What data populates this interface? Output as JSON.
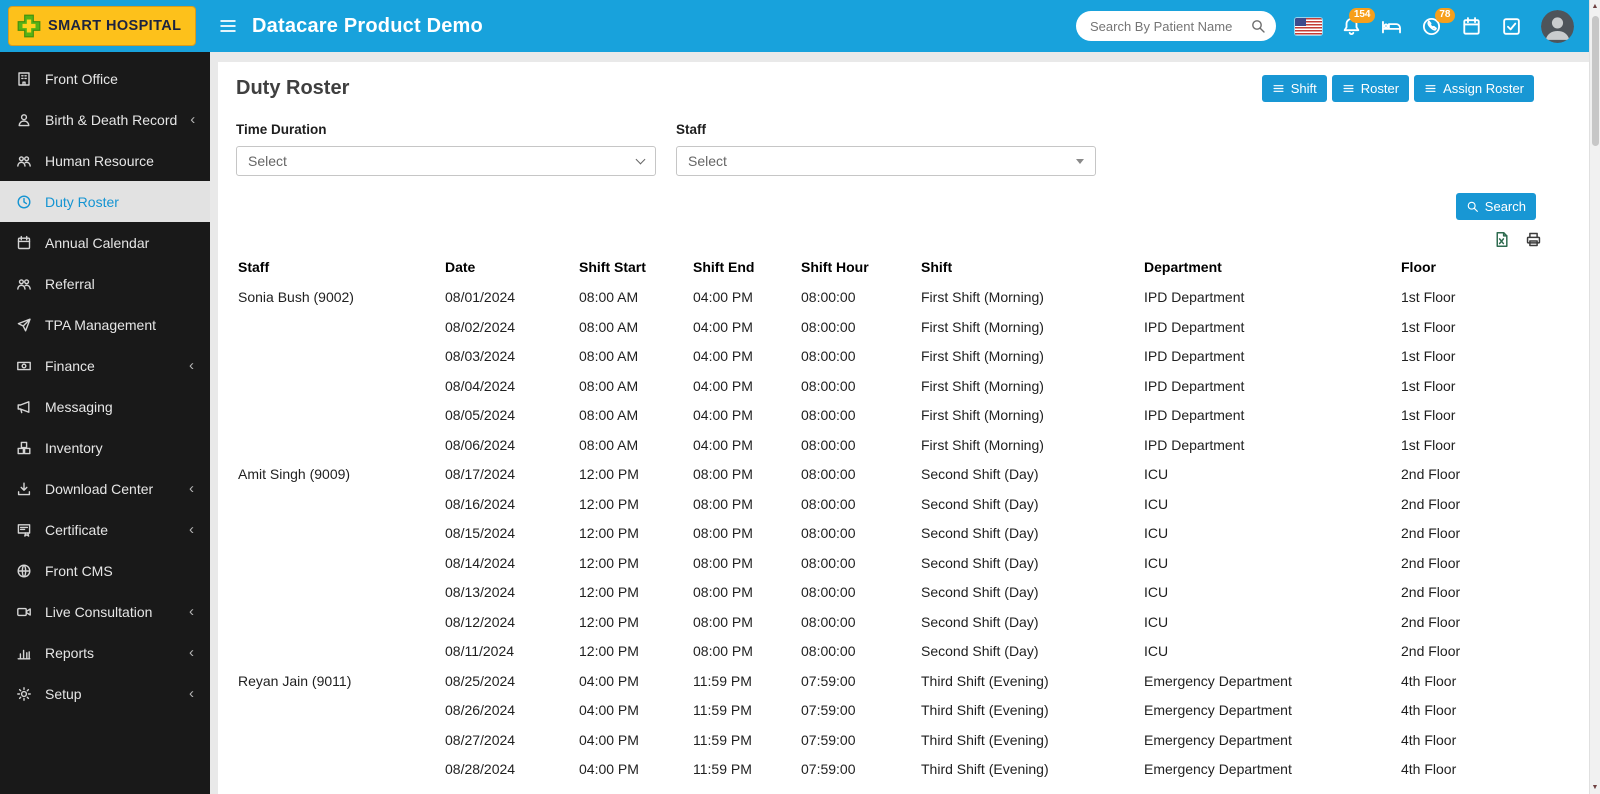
{
  "header": {
    "logo_text": "SMART HOSPITAL",
    "title": "Datacare Product Demo",
    "search_placeholder": "Search By Patient Name",
    "notification_count": "154",
    "message_count": "78"
  },
  "sidebar": {
    "items": [
      {
        "label": "Front Office",
        "icon": "front-office-icon",
        "chevron": false,
        "active": false
      },
      {
        "label": "Birth & Death Record",
        "icon": "birth-death-icon",
        "chevron": true,
        "active": false
      },
      {
        "label": "Human Resource",
        "icon": "human-resource-icon",
        "chevron": false,
        "active": false
      },
      {
        "label": "Duty Roster",
        "icon": "clock-icon",
        "chevron": false,
        "active": true
      },
      {
        "label": "Annual Calendar",
        "icon": "calendar-icon",
        "chevron": false,
        "active": false
      },
      {
        "label": "Referral",
        "icon": "users-icon",
        "chevron": false,
        "active": false
      },
      {
        "label": "TPA Management",
        "icon": "plane-icon",
        "chevron": false,
        "active": false
      },
      {
        "label": "Finance",
        "icon": "finance-icon",
        "chevron": true,
        "active": false
      },
      {
        "label": "Messaging",
        "icon": "megaphone-icon",
        "chevron": false,
        "active": false
      },
      {
        "label": "Inventory",
        "icon": "inventory-icon",
        "chevron": false,
        "active": false
      },
      {
        "label": "Download Center",
        "icon": "download-icon",
        "chevron": true,
        "active": false
      },
      {
        "label": "Certificate",
        "icon": "certificate-icon",
        "chevron": true,
        "active": false
      },
      {
        "label": "Front CMS",
        "icon": "globe-icon",
        "chevron": false,
        "active": false
      },
      {
        "label": "Live Consultation",
        "icon": "video-icon",
        "chevron": true,
        "active": false
      },
      {
        "label": "Reports",
        "icon": "chart-icon",
        "chevron": true,
        "active": false
      },
      {
        "label": "Setup",
        "icon": "gears-icon",
        "chevron": true,
        "active": false
      }
    ]
  },
  "page": {
    "title": "Duty Roster",
    "buttons": [
      {
        "label": "Shift"
      },
      {
        "label": "Roster"
      },
      {
        "label": "Assign Roster"
      }
    ],
    "filters": {
      "time_duration_label": "Time Duration",
      "time_duration_value": "Select",
      "staff_label": "Staff",
      "staff_value": "Select"
    },
    "search_button": "Search"
  },
  "table": {
    "columns": [
      "Staff",
      "Date",
      "Shift Start",
      "Shift End",
      "Shift Hour",
      "Shift",
      "Department",
      "Floor"
    ],
    "rows": [
      [
        "Sonia Bush (9002)",
        "08/01/2024",
        "08:00 AM",
        "04:00 PM",
        "08:00:00",
        "First Shift (Morning)",
        "IPD Department",
        "1st Floor"
      ],
      [
        "",
        "08/02/2024",
        "08:00 AM",
        "04:00 PM",
        "08:00:00",
        "First Shift (Morning)",
        "IPD Department",
        "1st Floor"
      ],
      [
        "",
        "08/03/2024",
        "08:00 AM",
        "04:00 PM",
        "08:00:00",
        "First Shift (Morning)",
        "IPD Department",
        "1st Floor"
      ],
      [
        "",
        "08/04/2024",
        "08:00 AM",
        "04:00 PM",
        "08:00:00",
        "First Shift (Morning)",
        "IPD Department",
        "1st Floor"
      ],
      [
        "",
        "08/05/2024",
        "08:00 AM",
        "04:00 PM",
        "08:00:00",
        "First Shift (Morning)",
        "IPD Department",
        "1st Floor"
      ],
      [
        "",
        "08/06/2024",
        "08:00 AM",
        "04:00 PM",
        "08:00:00",
        "First Shift (Morning)",
        "IPD Department",
        "1st Floor"
      ],
      [
        "Amit Singh (9009)",
        "08/17/2024",
        "12:00 PM",
        "08:00 PM",
        "08:00:00",
        "Second Shift (Day)",
        "ICU",
        "2nd Floor"
      ],
      [
        "",
        "08/16/2024",
        "12:00 PM",
        "08:00 PM",
        "08:00:00",
        "Second Shift (Day)",
        "ICU",
        "2nd Floor"
      ],
      [
        "",
        "08/15/2024",
        "12:00 PM",
        "08:00 PM",
        "08:00:00",
        "Second Shift (Day)",
        "ICU",
        "2nd Floor"
      ],
      [
        "",
        "08/14/2024",
        "12:00 PM",
        "08:00 PM",
        "08:00:00",
        "Second Shift (Day)",
        "ICU",
        "2nd Floor"
      ],
      [
        "",
        "08/13/2024",
        "12:00 PM",
        "08:00 PM",
        "08:00:00",
        "Second Shift (Day)",
        "ICU",
        "2nd Floor"
      ],
      [
        "",
        "08/12/2024",
        "12:00 PM",
        "08:00 PM",
        "08:00:00",
        "Second Shift (Day)",
        "ICU",
        "2nd Floor"
      ],
      [
        "",
        "08/11/2024",
        "12:00 PM",
        "08:00 PM",
        "08:00:00",
        "Second Shift (Day)",
        "ICU",
        "2nd Floor"
      ],
      [
        "Reyan Jain (9011)",
        "08/25/2024",
        "04:00 PM",
        "11:59 PM",
        "07:59:00",
        "Third Shift (Evening)",
        "Emergency Department",
        "4th Floor"
      ],
      [
        "",
        "08/26/2024",
        "04:00 PM",
        "11:59 PM",
        "07:59:00",
        "Third Shift (Evening)",
        "Emergency Department",
        "4th Floor"
      ],
      [
        "",
        "08/27/2024",
        "04:00 PM",
        "11:59 PM",
        "07:59:00",
        "Third Shift (Evening)",
        "Emergency Department",
        "4th Floor"
      ],
      [
        "",
        "08/28/2024",
        "04:00 PM",
        "11:59 PM",
        "07:59:00",
        "Third Shift (Evening)",
        "Emergency Department",
        "4th Floor"
      ]
    ]
  }
}
